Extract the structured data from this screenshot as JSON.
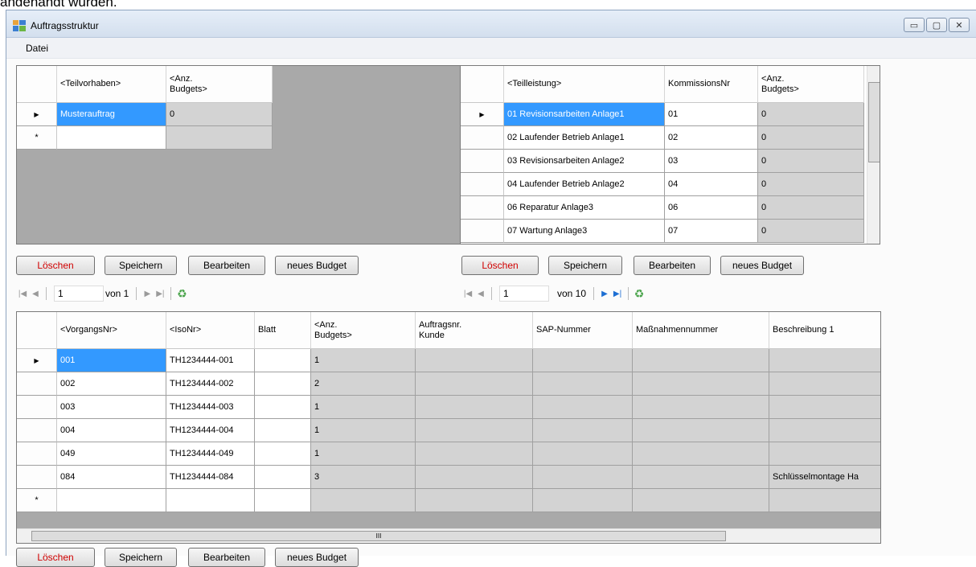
{
  "doc_line": "angehängt wurden.",
  "window": {
    "title": "Auftragsstruktur",
    "buttons": {
      "minimize": "▭",
      "maximize": "▢",
      "close": "✕"
    }
  },
  "menu": {
    "file": "Datei"
  },
  "colors": {
    "selection": "#3399ff",
    "delete_text": "#d00000",
    "grid_background": "#a9a9a9"
  },
  "grid1": {
    "headers": [
      "<Teilvorhaben>",
      "<Anz.\nBudgets>"
    ],
    "rows": [
      [
        "Musterauftrag",
        "0"
      ],
      [
        "",
        ""
      ]
    ]
  },
  "grid2": {
    "headers": [
      "<Teilleistung>",
      "KommissionsNr",
      "<Anz.\nBudgets>"
    ],
    "rows": [
      [
        "01 Revisionsarbeiten Anlage1",
        "01",
        "0"
      ],
      [
        "02 Laufender Betrieb Anlage1",
        "02",
        "0"
      ],
      [
        "03 Revisionsarbeiten Anlage2",
        "03",
        "0"
      ],
      [
        "04 Laufender Betrieb Anlage2",
        "04",
        "0"
      ],
      [
        "06 Reparatur Anlage3",
        "06",
        "0"
      ],
      [
        "07 Wartung Anlage3",
        "07",
        "0"
      ]
    ]
  },
  "grid3": {
    "headers": [
      "<VorgangsNr>",
      "<IsoNr>",
      "Blatt",
      "<Anz.\nBudgets>",
      "Auftragsnr.\nKunde",
      "SAP-Nummer",
      "Maßnahmennummer",
      "Beschreibung 1"
    ],
    "rows": [
      [
        "001",
        "TH1234444-001",
        "",
        "1",
        "",
        "",
        "",
        ""
      ],
      [
        "002",
        "TH1234444-002",
        "",
        "2",
        "",
        "",
        "",
        ""
      ],
      [
        "003",
        "TH1234444-003",
        "",
        "1",
        "",
        "",
        "",
        ""
      ],
      [
        "004",
        "TH1234444-004",
        "",
        "1",
        "",
        "",
        "",
        ""
      ],
      [
        "049",
        "TH1234444-049",
        "",
        "1",
        "",
        "",
        "",
        ""
      ],
      [
        "084",
        "TH1234444-084",
        "",
        "3",
        "",
        "",
        "",
        "Schlüsselmontage Ha"
      ],
      [
        "",
        "",
        "",
        "",
        "",
        "",
        "",
        ""
      ]
    ],
    "scroll_grip": "III"
  },
  "buttons": {
    "delete": "Löschen",
    "save": "Speichern",
    "edit": "Bearbeiten",
    "new_budget": "neues Budget"
  },
  "nav1": {
    "position": "1",
    "count": "von 1"
  },
  "nav2": {
    "position": "1",
    "count": "von 10"
  },
  "row_markers": {
    "current": "▶",
    "new": "*"
  }
}
